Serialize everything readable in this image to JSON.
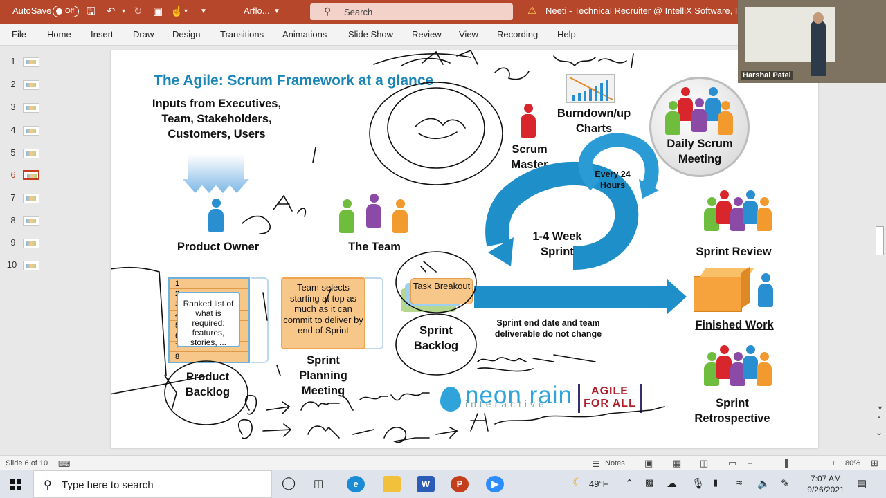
{
  "titlebar": {
    "autosave_label": "AutoSave",
    "autosave_state": "Off",
    "doc_title": "Arflo...",
    "search_placeholder": "Search",
    "meeting_title": "Neeti - Technical Recruiter @ IntelliX Software, Inc."
  },
  "ribbon": {
    "tabs": [
      "File",
      "Home",
      "Insert",
      "Draw",
      "Design",
      "Transitions",
      "Animations",
      "Slide Show",
      "Review",
      "View",
      "Recording",
      "Help"
    ]
  },
  "thumbnails": {
    "items": [
      "1",
      "2",
      "3",
      "4",
      "5",
      "6",
      "7",
      "8",
      "9",
      "10"
    ],
    "active_index": 6
  },
  "slide": {
    "title": "The Agile: Scrum Framework at a glance",
    "inputs_text": "Inputs from Executives, Team, Stakeholders, Customers, Users",
    "product_owner": "Product Owner",
    "the_team": "The Team",
    "scrum_master": "Scrum Master",
    "burndown": "Burndown/up Charts",
    "daily_scrum": "Daily Scrum Meeting",
    "every_24": "Every 24 Hours",
    "sprint_cycle": "1-4 Week Sprint",
    "sprint_review": "Sprint Review",
    "finished_work": "Finished Work",
    "sprint_retro": "Sprint Retrospective",
    "backlog_rows": [
      "1",
      "2",
      "3",
      "4",
      "5",
      "6",
      "7",
      "8"
    ],
    "backlog_box": "Ranked list of what is required: features, stories, ...",
    "product_backlog": "Product Backlog",
    "planning_box": "Team selects starting at top as much as it can commit to deliver by end of Sprint",
    "sprint_planning": "Sprint Planning Meeting",
    "task_breakout": "Task Breakout",
    "sprint_backlog": "Sprint Backlog",
    "sprint_note": "Sprint end date and team deliverable do not change",
    "logo_neon": "neon rain",
    "logo_neon_sub": "interactive",
    "logo_agile_1": "AGILE",
    "logo_agile_2": "FOR ALL"
  },
  "webcam": {
    "participant": "Harshal Patel"
  },
  "statusbar": {
    "slide_info": "Slide 6 of 10",
    "notes_label": "Notes",
    "zoom": "80%"
  },
  "taskbar": {
    "search_placeholder": "Type here to search",
    "weather": "49°F",
    "time": "7:07 AM",
    "date": "9/26/2021"
  },
  "colors": {
    "accent": "#b7472a",
    "slide_title": "#1a86b8",
    "cycle_blue": "#1f8fc9",
    "backlog_orange": "#f7c78a"
  }
}
